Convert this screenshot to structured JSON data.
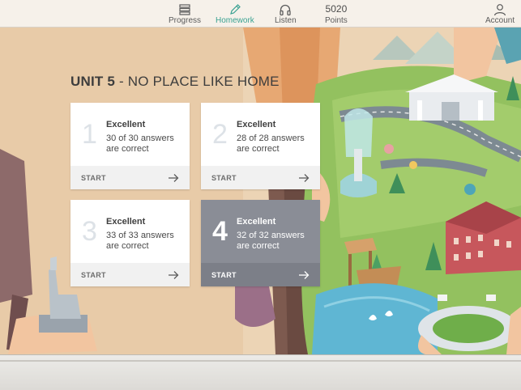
{
  "nav": {
    "progress_label": "Progress",
    "homework_label": "Homework",
    "listen_label": "Listen",
    "points_value": "5020",
    "points_label": "Points",
    "account_label": "Account",
    "active_tab": "Homework",
    "accent_color": "#3aa292"
  },
  "unit": {
    "number": "UNIT 5",
    "title": "- NO PLACE LIKE HOME"
  },
  "lessons": [
    {
      "number": "1",
      "status": "Excellent",
      "detail": "30 of 30 answers are correct",
      "action": "START",
      "highlighted": false
    },
    {
      "number": "2",
      "status": "Excellent",
      "detail": "28 of 28 answers are correct",
      "action": "START",
      "highlighted": false
    },
    {
      "number": "3",
      "status": "Excellent",
      "detail": "33 of 33 answers are correct",
      "action": "START",
      "highlighted": false
    },
    {
      "number": "4",
      "status": "Excellent",
      "detail": "32 of 32 answers are correct",
      "action": "START",
      "highlighted": true
    }
  ],
  "icons": {
    "progress": "progress-list-icon",
    "homework": "pencil-icon",
    "listen": "headphones-icon",
    "account": "user-icon",
    "card_arrow": "arrow-right-icon"
  }
}
